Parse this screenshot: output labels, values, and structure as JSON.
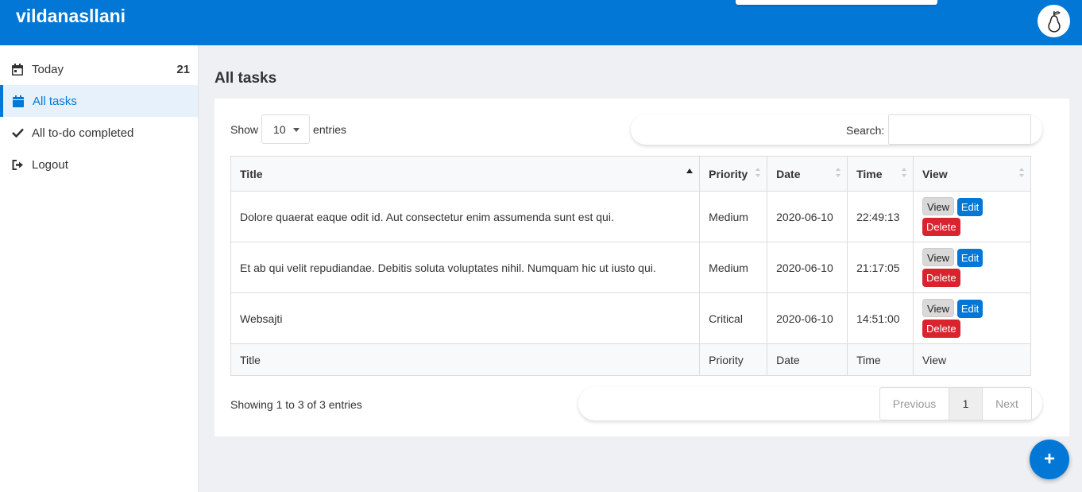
{
  "header": {
    "brand": "vildanasllani"
  },
  "sidebar": {
    "items": [
      {
        "label": "Today",
        "count": "21",
        "icon": "calendar-day-icon"
      },
      {
        "label": "All tasks",
        "icon": "calendar-icon",
        "active": true
      },
      {
        "label": "All to-do completed",
        "icon": "check-icon"
      },
      {
        "label": "Logout",
        "icon": "sign-out-icon"
      }
    ]
  },
  "main": {
    "title": "All tasks",
    "length": {
      "show": "Show",
      "value": "10",
      "entries": "entries"
    },
    "search": {
      "label": "Search:",
      "value": ""
    },
    "table": {
      "columns": [
        "Title",
        "Priority",
        "Date",
        "Time",
        "View"
      ],
      "rows": [
        {
          "title": "Dolore quaerat eaque odit id. Aut consectetur enim assumenda sunt est qui.",
          "priority": "Medium",
          "date": "2020-06-10",
          "time": "22:49:13"
        },
        {
          "title": "Et ab qui velit repudiandae. Debitis soluta voluptates nihil. Numquam hic ut iusto qui.",
          "priority": "Medium",
          "date": "2020-06-10",
          "time": "21:17:05"
        },
        {
          "title": "Websajti",
          "priority": "Critical",
          "date": "2020-06-10",
          "time": "14:51:00"
        }
      ],
      "actions": {
        "view": "View",
        "edit": "Edit",
        "delete": "Delete"
      }
    },
    "info": "Showing 1 to 3 of 3 entries",
    "pagination": {
      "previous": "Previous",
      "page": "1",
      "next": "Next"
    }
  },
  "fab": {
    "label": "+"
  },
  "colors": {
    "primary": "#0277d6",
    "danger": "#d9232d",
    "background": "#eef0f3"
  }
}
